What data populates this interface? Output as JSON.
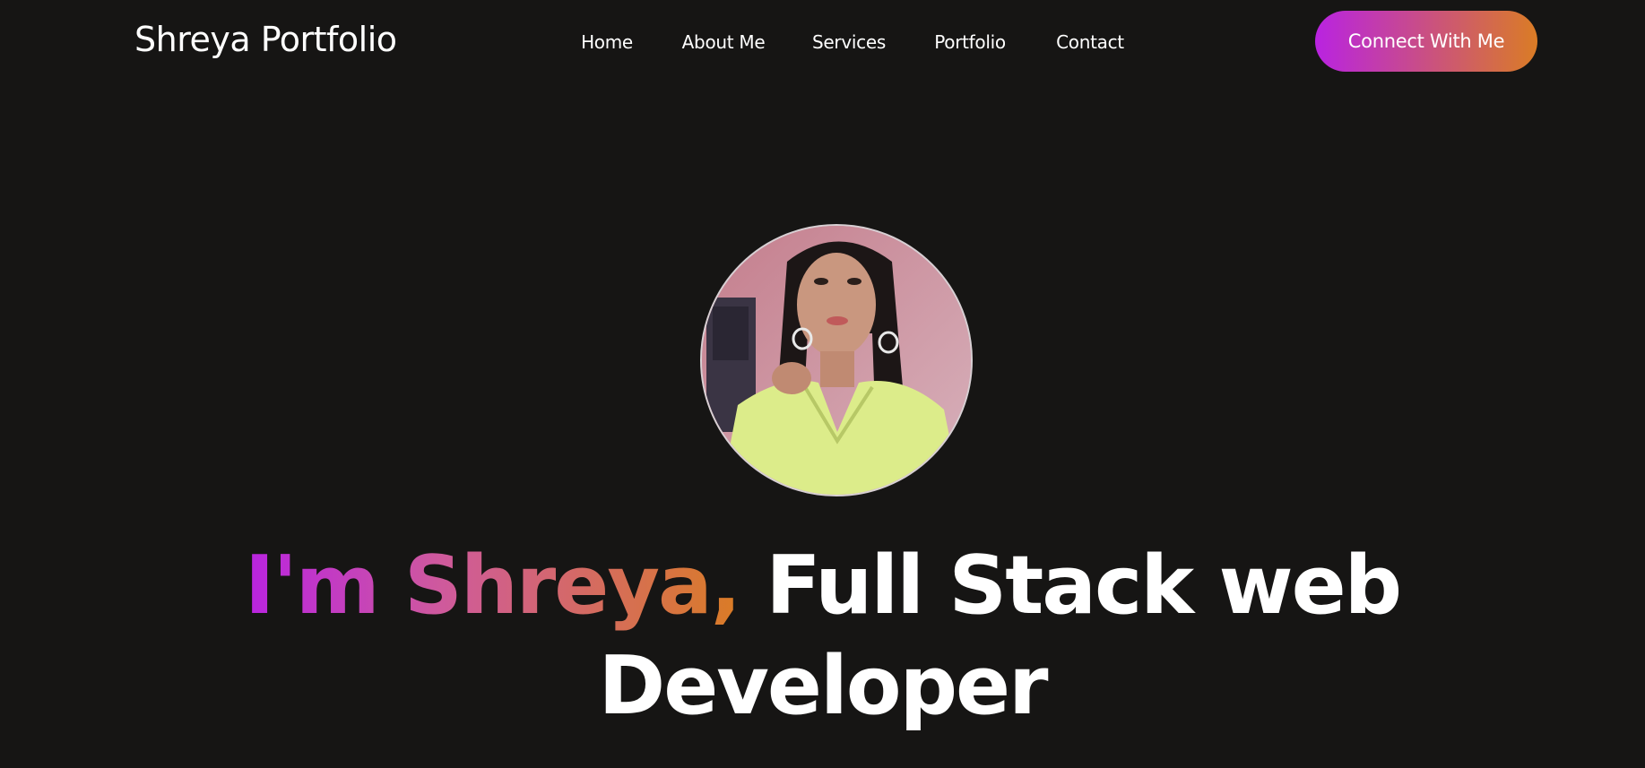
{
  "header": {
    "logo": "Shreya Portfolio",
    "nav": [
      {
        "label": "Home"
      },
      {
        "label": "About Me"
      },
      {
        "label": "Services"
      },
      {
        "label": "Portfolio"
      },
      {
        "label": "Contact"
      }
    ],
    "cta_label": "Connect With Me"
  },
  "hero": {
    "name_part": "I'm Shreya,",
    "role_line1": "Full Stack web",
    "role_line2": "Developer",
    "avatar_icon": "profile-photo"
  },
  "colors": {
    "background": "#161514",
    "gradient_start": "#b923e1",
    "gradient_end": "#da7c25",
    "text": "#ffffff"
  }
}
